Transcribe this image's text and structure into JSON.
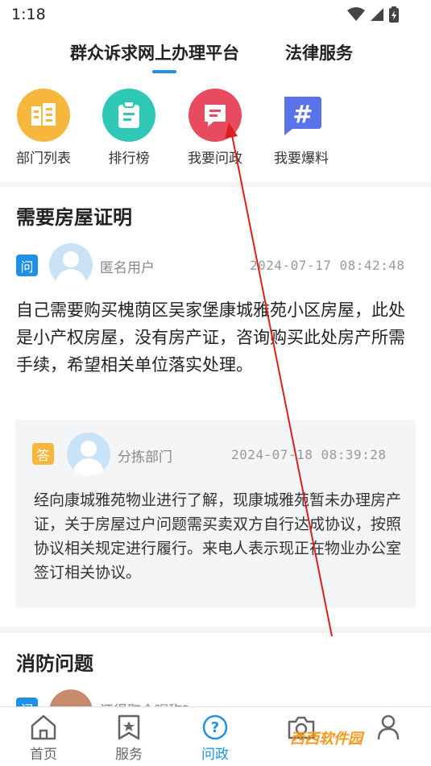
{
  "status_bar": {
    "time": "1:18"
  },
  "header": {
    "tabs": [
      "群众诉求网上办理平台",
      "法律服务"
    ]
  },
  "shortcuts": [
    {
      "label": "部门列表",
      "icon": "building-icon",
      "color": "#f6b73c"
    },
    {
      "label": "排行榜",
      "icon": "clipboard-icon",
      "color": "#2ec8b5"
    },
    {
      "label": "我要问政",
      "icon": "message-icon",
      "color": "#e84a5f"
    },
    {
      "label": "我要爆料",
      "icon": "hashtag-icon",
      "color": "#5b73e8"
    }
  ],
  "posts": [
    {
      "title": "需要房屋证明",
      "question_badge": "问",
      "user": "匿名用户",
      "date": "2024-07-17  08:42:48",
      "content": "自己需要购买槐荫区吴家堡康城雅苑小区房屋，此处是小产权房屋，没有房产证，咨询购买此处房产所需手续，希望相关单位落实处理。",
      "answer": {
        "badge": "答",
        "dept": "分拣部门",
        "date": "2024-07-18  08:39:28",
        "content": "经向康城雅苑物业进行了解，现康城雅苑暂未办理房产证，关于房屋过户问题需买卖双方自行达成协议，按照协议相关规定进行履行。来电人表示现正在物业办公室签订相关协议。"
      }
    },
    {
      "title": "消防问题",
      "question_badge": "问",
      "user": "还得取个昵称?"
    }
  ],
  "bottom_nav": [
    {
      "label": "首页",
      "icon": "home-icon"
    },
    {
      "label": "服务",
      "icon": "star-bookmark-icon"
    },
    {
      "label": "问政",
      "icon": "question-icon",
      "active": true
    },
    {
      "label": "",
      "icon": "camera-icon"
    },
    {
      "label": "",
      "icon": "person-icon"
    }
  ],
  "colors": {
    "accent": "#1e90e6",
    "question_badge": "#1e90e6",
    "answer_badge": "#f6b73c"
  },
  "watermark": "西西软件园"
}
